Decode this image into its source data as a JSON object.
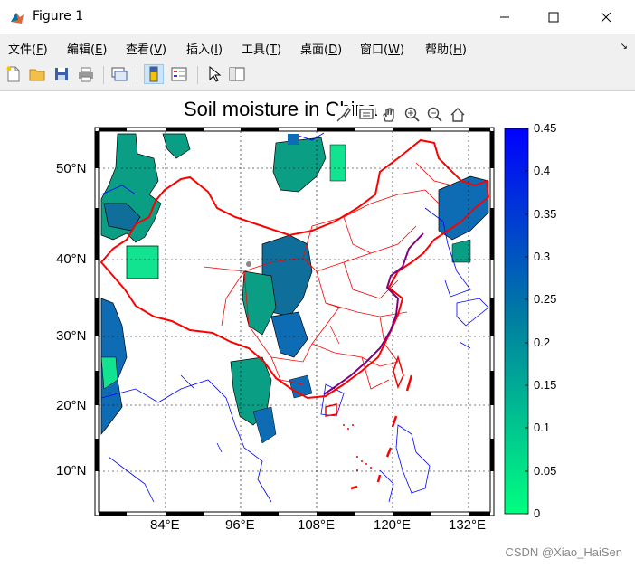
{
  "window": {
    "title": "Figure 1",
    "controls": [
      "minimize-icon",
      "maximize-icon",
      "close-icon"
    ]
  },
  "menu": [
    {
      "label": "文件",
      "key": "F"
    },
    {
      "label": "编辑",
      "key": "E"
    },
    {
      "label": "查看",
      "key": "V"
    },
    {
      "label": "插入",
      "key": "I"
    },
    {
      "label": "工具",
      "key": "T"
    },
    {
      "label": "桌面",
      "key": "D"
    },
    {
      "label": "窗口",
      "key": "W"
    },
    {
      "label": "帮助",
      "key": "H"
    }
  ],
  "toolbar": [
    "new-figure-icon",
    "open-file-icon",
    "save-icon",
    "print-icon",
    "link-icon",
    "colorbar-icon",
    "legend-icon",
    "pointer-icon",
    "property-editor-icon"
  ],
  "axes_toolbar": [
    "brush-icon",
    "data-tips-icon",
    "pan-icon",
    "zoom-in-icon",
    "zoom-out-icon",
    "home-icon"
  ],
  "plot": {
    "title": "Soil moisture in China",
    "lat_labels": [
      "50°N",
      "40°N",
      "30°N",
      "20°N",
      "10°N"
    ],
    "lon_labels": [
      "84°E",
      "96°E",
      "108°E",
      "120°E",
      "132°E"
    ]
  },
  "colorbar": {
    "labels": [
      "0.45",
      "0.4",
      "0.35",
      "0.3",
      "0.25",
      "0.2",
      "0.15",
      "0.1",
      "0.05",
      "0"
    ],
    "min": 0,
    "max": 0.45,
    "color_low": "#00ff80",
    "color_high": "#0000ff"
  },
  "watermark": "CSDN @Xiao_HaiSen",
  "colors": {
    "china_border": "#ff0000",
    "province": "#ff0000",
    "coast": "#0000ff",
    "highlight_coast": "#800080"
  }
}
